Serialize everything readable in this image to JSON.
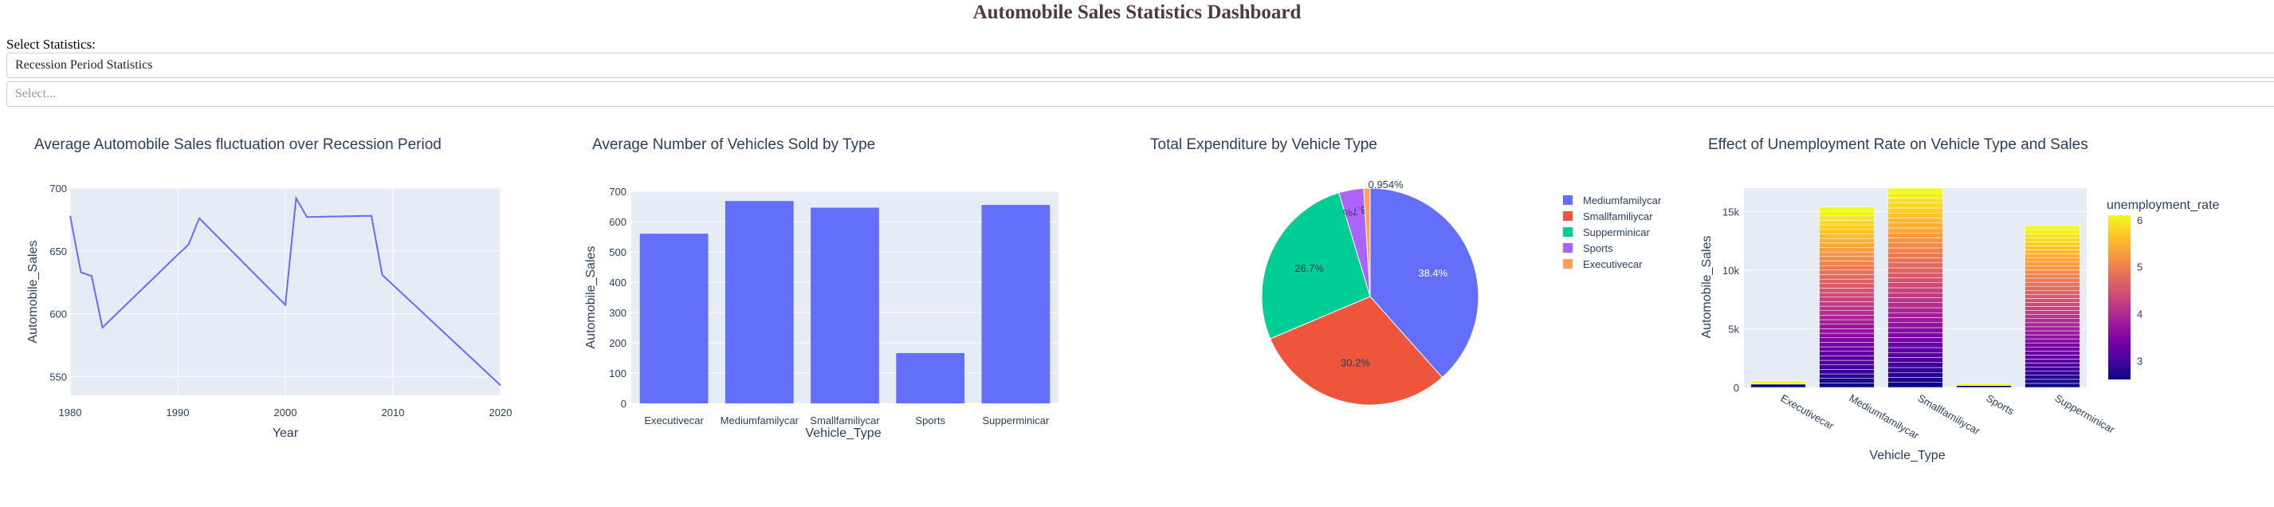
{
  "header": {
    "title": "Automobile Sales Statistics Dashboard"
  },
  "controls": {
    "select_label": "Select Statistics:",
    "statistics_dropdown_value": "Recession Period Statistics",
    "year_dropdown_placeholder": "Select..."
  },
  "colors": {
    "title": "#503A3A",
    "plot_bg": "#E5ECF6",
    "bar": "#636EFA",
    "line": "#636EFA",
    "pie": [
      "#636EFA",
      "#EF553B",
      "#00CC96",
      "#AB63FA",
      "#FFA15A"
    ],
    "plasma": [
      "#0d0887",
      "#46039f",
      "#7201a8",
      "#9c179e",
      "#bd3786",
      "#d8576b",
      "#ed7953",
      "#fb9f3a",
      "#fdca26",
      "#f0f921"
    ]
  },
  "chart_data": [
    {
      "type": "line",
      "title": "Average Automobile Sales fluctuation over Recession Period",
      "xlabel": "Year",
      "ylabel": "Automobile_Sales",
      "x": [
        1980,
        1981,
        1982,
        1983,
        1990,
        1991,
        1992,
        2000,
        2001,
        2002,
        2008,
        2009,
        2020
      ],
      "y": [
        678,
        633,
        630,
        589,
        647,
        655,
        676,
        607,
        692,
        677,
        678,
        631,
        543
      ],
      "xlim": [
        1980,
        2020
      ],
      "ylim": [
        535,
        700
      ],
      "xticks": [
        1980,
        1990,
        2000,
        2010,
        2020
      ],
      "yticks": [
        550,
        600,
        650,
        700
      ],
      "grid": true
    },
    {
      "type": "bar",
      "title": "Average Number of Vehicles Sold by Type",
      "xlabel": "Vehicle_Type",
      "ylabel": "Automobile_Sales",
      "categories": [
        "Executivecar",
        "Mediumfamilycar",
        "Smallfamiliycar",
        "Sports",
        "Supperminicar"
      ],
      "values": [
        560,
        668,
        646,
        166,
        655
      ],
      "ylim": [
        0,
        700
      ],
      "yticks": [
        0,
        100,
        200,
        300,
        400,
        500,
        600,
        700
      ],
      "grid": true
    },
    {
      "type": "pie",
      "title": "Total Expenditure by Vehicle Type",
      "labels": [
        "Mediumfamilycar",
        "Smallfamiliycar",
        "Supperminicar",
        "Sports",
        "Executivecar"
      ],
      "percent_labels": [
        "38.4%",
        "30.2%",
        "26.7%",
        "3.7%",
        "0.954%"
      ],
      "values": [
        38.4,
        30.2,
        26.7,
        3.7,
        0.954
      ],
      "legend": "right"
    },
    {
      "type": "bar",
      "title": "Effect of Unemployment Rate on Vehicle Type and Sales",
      "xlabel": "Vehicle_Type",
      "ylabel": "Automobile_Sales",
      "categories": [
        "Executivecar",
        "Mediumfamilycar",
        "Smallfamiliycar",
        "Sports",
        "Supperminicar"
      ],
      "values": [
        560,
        15400,
        17000,
        330,
        13800
      ],
      "ylim": [
        0,
        17000
      ],
      "yticks": [
        0,
        5000,
        10000,
        15000
      ],
      "ytick_labels": [
        "0",
        "5k",
        "10k",
        "15k"
      ],
      "color_scale": {
        "title": "unemployment_rate",
        "range": [
          2.6,
          6.1
        ],
        "ticks": [
          3,
          4,
          5,
          6
        ],
        "scale": "plasma"
      },
      "grid": true
    }
  ]
}
